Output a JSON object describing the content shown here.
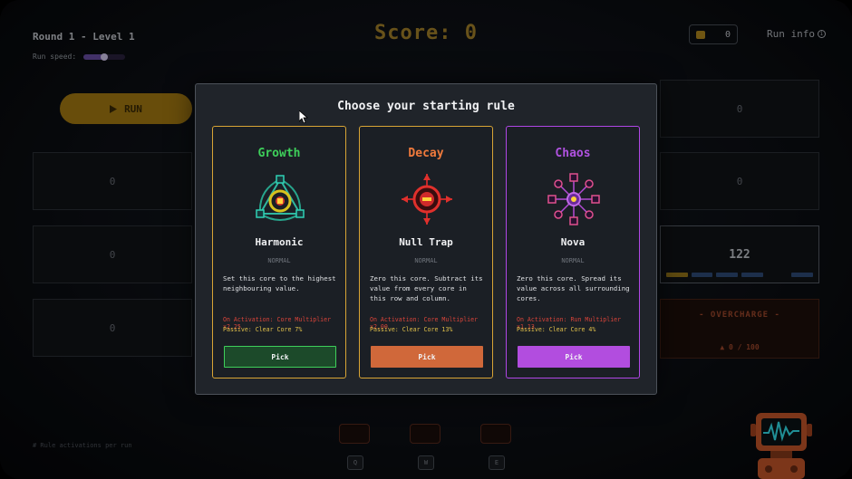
{
  "hud": {
    "round_level": "Round 1 - Level 1",
    "run_speed_label": "Run speed:",
    "run_speed_level": 0.5,
    "score_text": "Score: 0",
    "coins": "0",
    "run_info_label": "Run info",
    "run_button_label": "RUN",
    "run_button_icon": "play-icon"
  },
  "grid": {
    "cell_values": [
      "0",
      "0",
      "0",
      "0",
      "0",
      "0",
      "0",
      "0"
    ],
    "highlighted_value": "122",
    "overcharge_label": "- OVERCHARGE -",
    "overcharge_count": "0 / 100"
  },
  "footer": {
    "rule_note": "# Rule activations per run",
    "keys": [
      "Q",
      "W",
      "E"
    ]
  },
  "modal": {
    "title": "Choose your starting rule",
    "cards": [
      {
        "category": "Growth",
        "name": "Harmonic",
        "rarity": "NORMAL",
        "description": "Set this core to the highest neighbouring value.",
        "activation": "On Activation: Core Multiplier x2.25",
        "passive": "Passive: Clear Core 7%",
        "pick_label": "Pick",
        "accent": "#3ecf5a",
        "border": "#d8a435",
        "button_color": "#1c4a2a",
        "icon": "harmonic-emblem-icon"
      },
      {
        "category": "Decay",
        "name": "Null Trap",
        "rarity": "NORMAL",
        "description": "Zero this core. Subtract its value from every core in this row and column.",
        "activation": "On Activation: Core Multiplier x2.00",
        "passive": "Passive: Clear Core 13%",
        "pick_label": "Pick",
        "accent": "#f07a3c",
        "border": "#d8a435",
        "button_color": "#d0683a",
        "icon": "null-trap-emblem-icon"
      },
      {
        "category": "Chaos",
        "name": "Nova",
        "rarity": "NORMAL",
        "description": "Zero this core. Spread its value across all surrounding cores.",
        "activation": "On Activation: Run Multiplier x1.13",
        "passive": "Passive: Clear Core 4%",
        "pick_label": "Pick",
        "accent": "#b052e0",
        "border": "#b046e6",
        "button_color": "#b24ddf",
        "icon": "nova-emblem-icon"
      }
    ]
  }
}
